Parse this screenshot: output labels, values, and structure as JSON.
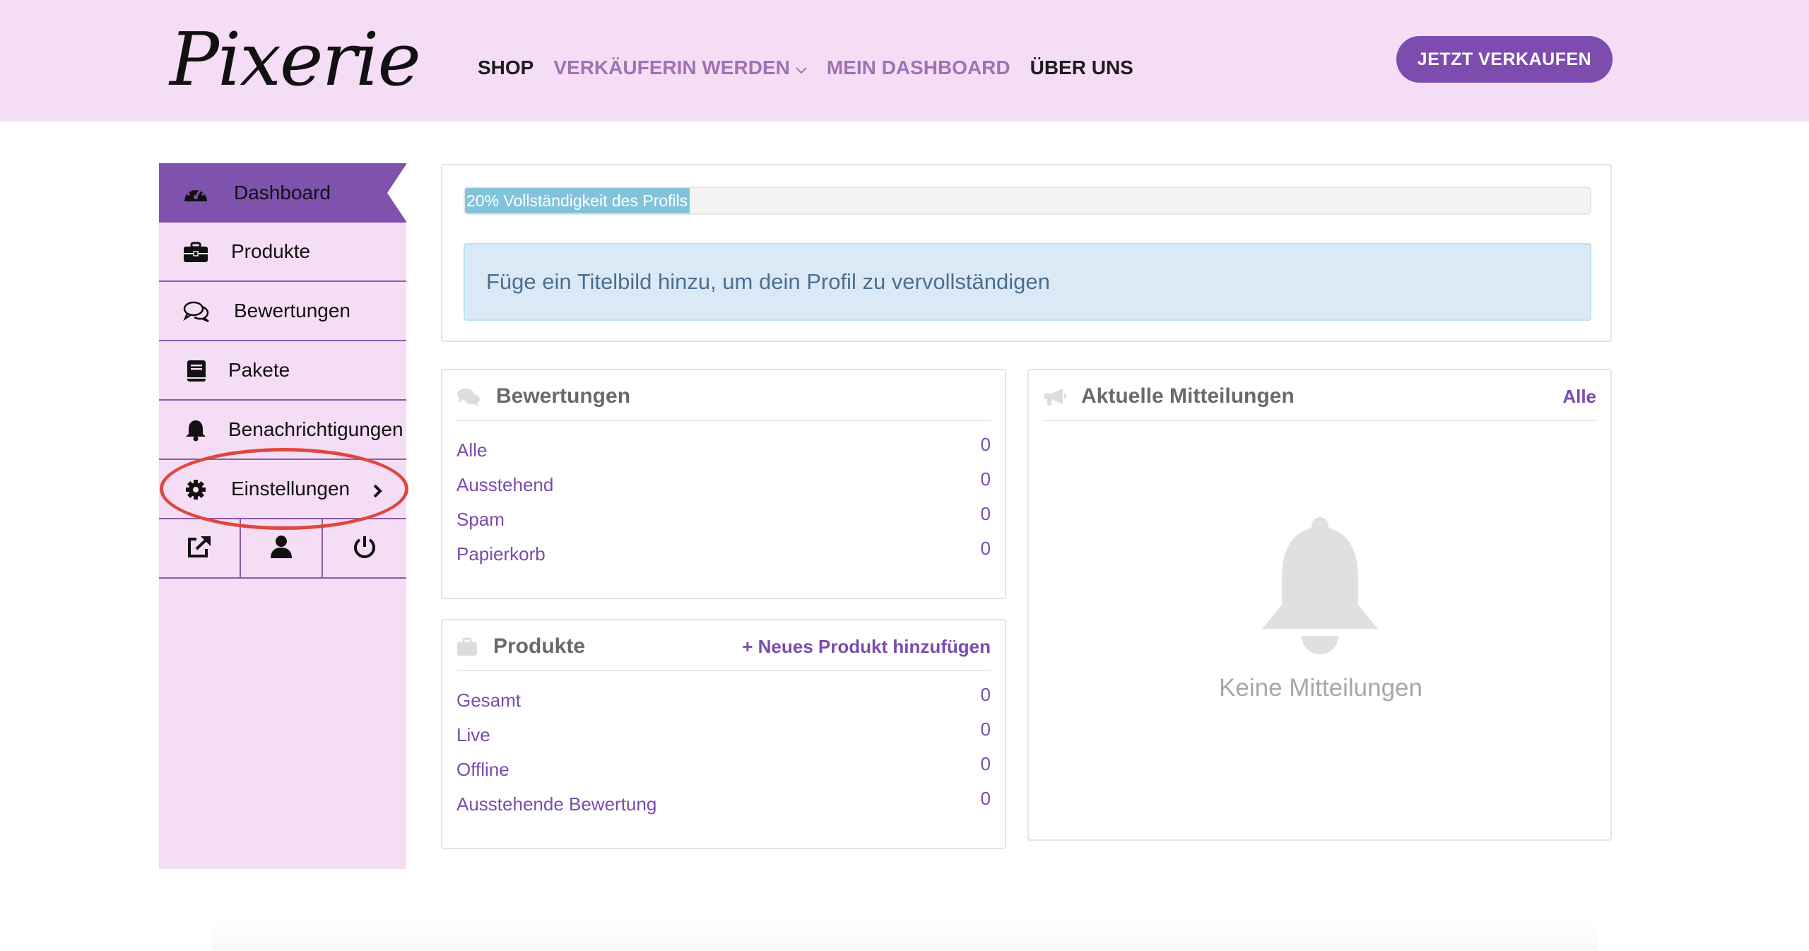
{
  "header": {
    "logo": "Pixerie",
    "nav": [
      {
        "label": "SHOP"
      },
      {
        "label": "VERKÄUFERIN WERDEN"
      },
      {
        "label": "MEIN DASHBOARD"
      },
      {
        "label": "ÜBER UNS"
      }
    ],
    "cta": "JETZT VERKAUFEN",
    "colors": {
      "header_bg": "#f5ddf6",
      "accent": "#7d4caf"
    }
  },
  "sidebar": {
    "items": [
      {
        "label": "Dashboard",
        "icon": "speedometer-icon",
        "active": true
      },
      {
        "label": "Produkte",
        "icon": "briefcase-icon"
      },
      {
        "label": "Bewertungen",
        "icon": "comments-icon"
      },
      {
        "label": "Pakete",
        "icon": "book-icon"
      },
      {
        "label": "Benachrichtigungen",
        "icon": "bell-icon"
      },
      {
        "label": "Einstellungen",
        "icon": "gear-icon",
        "has_submenu": true
      }
    ],
    "bottom_icons": [
      "external-link-icon",
      "user-icon",
      "power-icon"
    ]
  },
  "profile": {
    "progress_label": "20% Vollständigkeit des Profils",
    "progress_percent": 20,
    "notice": "Füge ein Titelbild hinzu, um dein Profil zu vervollständigen"
  },
  "reviews": {
    "title": "Bewertungen",
    "rows": [
      {
        "label": "Alle",
        "value": "0"
      },
      {
        "label": "Ausstehend",
        "value": "0"
      },
      {
        "label": "Spam",
        "value": "0"
      },
      {
        "label": "Papierkorb",
        "value": "0"
      }
    ]
  },
  "products": {
    "title": "Produkte",
    "add_link": "+ Neues Produkt hinzufügen",
    "rows": [
      {
        "label": "Gesamt",
        "value": "0"
      },
      {
        "label": "Live",
        "value": "0"
      },
      {
        "label": "Offline",
        "value": "0"
      },
      {
        "label": "Ausstehende Bewertung",
        "value": "0"
      }
    ]
  },
  "announcements": {
    "title": "Aktuelle Mitteilungen",
    "all_link": "Alle",
    "empty": "Keine Mitteilungen"
  }
}
